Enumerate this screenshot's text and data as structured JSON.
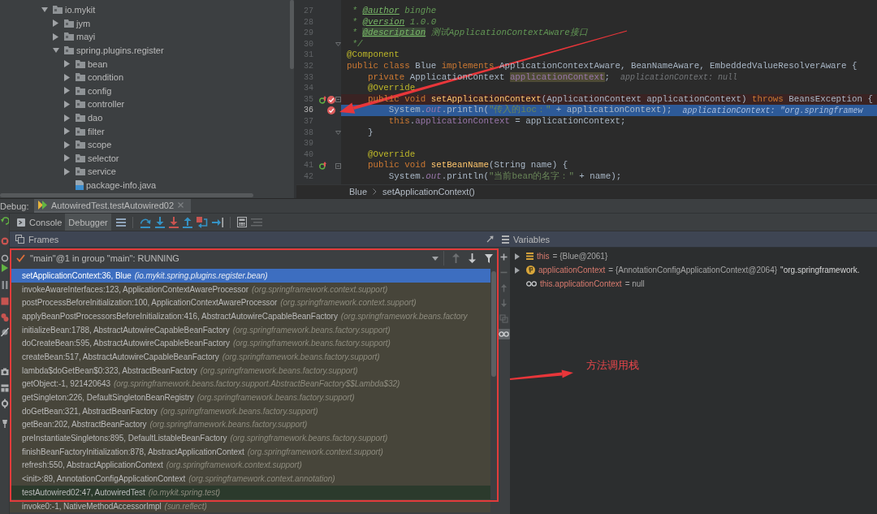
{
  "project_tree": {
    "items": [
      {
        "label": "io.mykit",
        "kind": "package",
        "expanded": true,
        "children": [
          {
            "label": "jym",
            "kind": "package",
            "expanded": false
          },
          {
            "label": "mayi",
            "kind": "package",
            "expanded": false
          },
          {
            "label": "spring.plugins.register",
            "kind": "package",
            "expanded": true,
            "children": [
              {
                "label": "bean",
                "kind": "package",
                "expanded": false
              },
              {
                "label": "condition",
                "kind": "package",
                "expanded": false
              },
              {
                "label": "config",
                "kind": "package",
                "expanded": false
              },
              {
                "label": "controller",
                "kind": "package",
                "expanded": false
              },
              {
                "label": "dao",
                "kind": "package",
                "expanded": false
              },
              {
                "label": "filter",
                "kind": "package",
                "expanded": false
              },
              {
                "label": "scope",
                "kind": "package",
                "expanded": false
              },
              {
                "label": "selector",
                "kind": "package",
                "expanded": false
              },
              {
                "label": "service",
                "kind": "package",
                "expanded": false
              },
              {
                "label": "package-info.java",
                "kind": "file"
              }
            ]
          }
        ]
      }
    ]
  },
  "editor": {
    "lines": [
      {
        "number": "27",
        "current": false,
        "tokens": [
          {
            "text": " * ",
            "kind": "comment"
          },
          {
            "text": "@author",
            "kind": "doc_tag"
          },
          {
            "text": " binghe",
            "kind": "comment"
          }
        ]
      },
      {
        "number": "28",
        "current": false,
        "tokens": [
          {
            "text": " * ",
            "kind": "comment"
          },
          {
            "text": "@version",
            "kind": "doc_tag"
          },
          {
            "text": " 1.0.0",
            "kind": "comment"
          }
        ]
      },
      {
        "number": "29",
        "current": false,
        "tokens": [
          {
            "text": " * ",
            "kind": "comment"
          },
          {
            "text": "@description",
            "kind": "doc_tag_marked"
          },
          {
            "text": " 测试ApplicationContextAware接口",
            "kind": "comment"
          }
        ]
      },
      {
        "number": "30",
        "current": false,
        "gutter": [
          {
            "kind": "fold_end"
          }
        ],
        "tokens": [
          {
            "text": " */",
            "kind": "comment"
          }
        ]
      },
      {
        "number": "31",
        "current": false,
        "tokens": [
          {
            "text": "@Component",
            "kind": "annotation"
          }
        ]
      },
      {
        "number": "32",
        "current": false,
        "tokens": [
          {
            "text": "public class ",
            "kind": "keyword"
          },
          {
            "text": "Blue ",
            "kind": "plain"
          },
          {
            "text": "implements",
            "kind": "keyword"
          },
          {
            "text": " ApplicationContextAware, BeanNameAware, EmbeddedValueResolverAware {",
            "kind": "plain"
          }
        ]
      },
      {
        "number": "33",
        "current": false,
        "hint": "applicationContext: null",
        "tokens": [
          {
            "text": "    private",
            "kind": "keyword"
          },
          {
            "text": " ApplicationContext ",
            "kind": "plain"
          },
          {
            "text": "applicationContext",
            "kind": "field_marked"
          },
          {
            "text": ";",
            "kind": "plain"
          }
        ]
      },
      {
        "number": "34",
        "current": false,
        "tokens": [
          {
            "text": "    @Override",
            "kind": "annotation"
          }
        ]
      },
      {
        "number": "35",
        "current": false,
        "gutter": [
          {
            "kind": "override"
          },
          {
            "kind": "breakpoint"
          },
          {
            "kind": "fold_start"
          }
        ],
        "tokens": [
          {
            "text": "    public void ",
            "kind": "keyword"
          },
          {
            "text": "setApplicationContext",
            "kind": "method_decl"
          },
          {
            "text": "(ApplicationContext applicationContext) ",
            "kind": "plain"
          },
          {
            "text": "throws",
            "kind": "keyword"
          },
          {
            "text": " BeansException {",
            "kind": "plain"
          }
        ]
      },
      {
        "number": "36",
        "current": true,
        "gutter": [
          {
            "kind": "breakpoint"
          }
        ],
        "hint": "applicationContext: \"org.springframew",
        "tokens": [
          {
            "text": "        System.",
            "kind": "plain"
          },
          {
            "text": "out",
            "kind": "static_field"
          },
          {
            "text": ".println(",
            "kind": "plain"
          },
          {
            "text": "\"传入的ioc：\"",
            "kind": "string"
          },
          {
            "text": " + applicationContext);",
            "kind": "plain"
          }
        ]
      },
      {
        "number": "37",
        "current": false,
        "tokens": [
          {
            "text": "        this",
            "kind": "keyword"
          },
          {
            "text": ".",
            "kind": "plain"
          },
          {
            "text": "applicationContext",
            "kind": "field"
          },
          {
            "text": " = applicationContext;",
            "kind": "plain"
          }
        ]
      },
      {
        "number": "38",
        "current": false,
        "gutter": [
          {
            "kind": "fold_end"
          }
        ],
        "tokens": [
          {
            "text": "    }",
            "kind": "plain"
          }
        ]
      },
      {
        "number": "39",
        "current": false
      },
      {
        "number": "40",
        "current": false,
        "tokens": [
          {
            "text": "    @Override",
            "kind": "annotation"
          }
        ]
      },
      {
        "number": "41",
        "current": false,
        "gutter": [
          {
            "kind": "override"
          },
          {
            "kind": "fold_start"
          }
        ],
        "tokens": [
          {
            "text": "    public void ",
            "kind": "keyword"
          },
          {
            "text": "setBeanName",
            "kind": "method_decl"
          },
          {
            "text": "(String name) {",
            "kind": "plain"
          }
        ]
      },
      {
        "number": "42",
        "current": false,
        "tokens": [
          {
            "text": "        System.",
            "kind": "plain"
          },
          {
            "text": "out",
            "kind": "static_field"
          },
          {
            "text": ".println(",
            "kind": "plain"
          },
          {
            "text": "\"当前bean的名字：\"",
            "kind": "string"
          },
          {
            "text": " + name);",
            "kind": "plain"
          }
        ]
      }
    ],
    "breadcrumbs": [
      "Blue",
      "setApplicationContext()"
    ]
  },
  "debug": {
    "label": "Debug:",
    "session_tab": {
      "label": "AutowiredTest.testAutowired02",
      "selected": true
    },
    "tabs": [
      {
        "label": "Console",
        "kind": "console",
        "selected": false
      },
      {
        "label": "Debugger",
        "kind": "debugger",
        "selected": true
      }
    ],
    "actions": [
      {
        "kind": "layout",
        "disabled": false
      },
      {
        "kind": "step_over",
        "disabled": false
      },
      {
        "kind": "step_into",
        "disabled": false
      },
      {
        "kind": "force_step_into",
        "disabled": false
      },
      {
        "kind": "step_out",
        "disabled": false
      },
      {
        "kind": "drop_frame",
        "disabled": false
      },
      {
        "kind": "run_to_cursor",
        "disabled": false
      },
      {
        "kind": "evaluate",
        "disabled": false
      },
      {
        "kind": "trace",
        "disabled": true
      }
    ]
  },
  "frames": {
    "title": "Frames",
    "thread": "\"main\"@1 in group \"main\": RUNNING",
    "nav": [
      {
        "kind": "up",
        "disabled": true
      },
      {
        "kind": "down",
        "disabled": false
      },
      {
        "kind": "filter",
        "disabled": false
      }
    ],
    "items": [
      {
        "frame": "setApplicationContext:36, Blue",
        "location": "(io.mykit.spring.plugins.register.bean)",
        "kind": "project",
        "selected": true
      },
      {
        "frame": "invokeAwareInterfaces:123, ApplicationContextAwareProcessor",
        "location": "(org.springframework.context.support)",
        "kind": "library",
        "selected": false
      },
      {
        "frame": "postProcessBeforeInitialization:100, ApplicationContextAwareProcessor",
        "location": "(org.springframework.context.support)",
        "kind": "library",
        "selected": false
      },
      {
        "frame": "applyBeanPostProcessorsBeforeInitialization:416, AbstractAutowireCapableBeanFactory",
        "location": "(org.springframework.beans.factory",
        "kind": "library",
        "selected": false
      },
      {
        "frame": "initializeBean:1788, AbstractAutowireCapableBeanFactory",
        "location": "(org.springframework.beans.factory.support)",
        "kind": "library",
        "selected": false
      },
      {
        "frame": "doCreateBean:595, AbstractAutowireCapableBeanFactory",
        "location": "(org.springframework.beans.factory.support)",
        "kind": "library",
        "selected": false
      },
      {
        "frame": "createBean:517, AbstractAutowireCapableBeanFactory",
        "location": "(org.springframework.beans.factory.support)",
        "kind": "library",
        "selected": false
      },
      {
        "frame": "lambda$doGetBean$0:323, AbstractBeanFactory",
        "location": "(org.springframework.beans.factory.support)",
        "kind": "library",
        "selected": false
      },
      {
        "frame": "getObject:-1, 921420643",
        "location": "(org.springframework.beans.factory.support.AbstractBeanFactory$$Lambda$32)",
        "kind": "library",
        "selected": false
      },
      {
        "frame": "getSingleton:226, DefaultSingletonBeanRegistry",
        "location": "(org.springframework.beans.factory.support)",
        "kind": "library",
        "selected": false
      },
      {
        "frame": "doGetBean:321, AbstractBeanFactory",
        "location": "(org.springframework.beans.factory.support)",
        "kind": "library",
        "selected": false
      },
      {
        "frame": "getBean:202, AbstractBeanFactory",
        "location": "(org.springframework.beans.factory.support)",
        "kind": "library",
        "selected": false
      },
      {
        "frame": "preInstantiateSingletons:895, DefaultListableBeanFactory",
        "location": "(org.springframework.beans.factory.support)",
        "kind": "library",
        "selected": false
      },
      {
        "frame": "finishBeanFactoryInitialization:878, AbstractApplicationContext",
        "location": "(org.springframework.context.support)",
        "kind": "library",
        "selected": false
      },
      {
        "frame": "refresh:550, AbstractApplicationContext",
        "location": "(org.springframework.context.support)",
        "kind": "library",
        "selected": false
      },
      {
        "frame": "<init>:89, AnnotationConfigApplicationContext",
        "location": "(org.springframework.context.annotation)",
        "kind": "library",
        "selected": false
      },
      {
        "frame": "testAutowired02:47, AutowiredTest",
        "location": "(io.mykit.spring.test)",
        "kind": "test",
        "selected": false
      },
      {
        "frame": "invoke0:-1, NativeMethodAccessorImpl",
        "location": "(sun.reflect)",
        "kind": "library",
        "selected": false
      }
    ]
  },
  "variables": {
    "title": "Variables",
    "toolbar": [
      {
        "kind": "add",
        "disabled": false,
        "on": false
      },
      {
        "kind": "remove",
        "disabled": true,
        "on": false
      },
      {
        "kind": "up",
        "disabled": true,
        "on": false
      },
      {
        "kind": "down",
        "disabled": true,
        "on": false
      },
      {
        "kind": "copy",
        "disabled": true,
        "on": false
      },
      {
        "kind": "watches",
        "disabled": false,
        "on": true
      }
    ],
    "items": [
      {
        "kind": "object",
        "expanded": false,
        "name": "this",
        "value": "= {Blue@2061}"
      },
      {
        "kind": "parameter",
        "expanded": false,
        "name": "applicationContext",
        "value": "= {AnnotationConfigApplicationContext@2064}",
        "detail": "\"org.springframework."
      },
      {
        "kind": "watch",
        "name": "this.applicationContext",
        "value": "= null"
      }
    ]
  },
  "annotation": {
    "label": "方法调用栈"
  }
}
